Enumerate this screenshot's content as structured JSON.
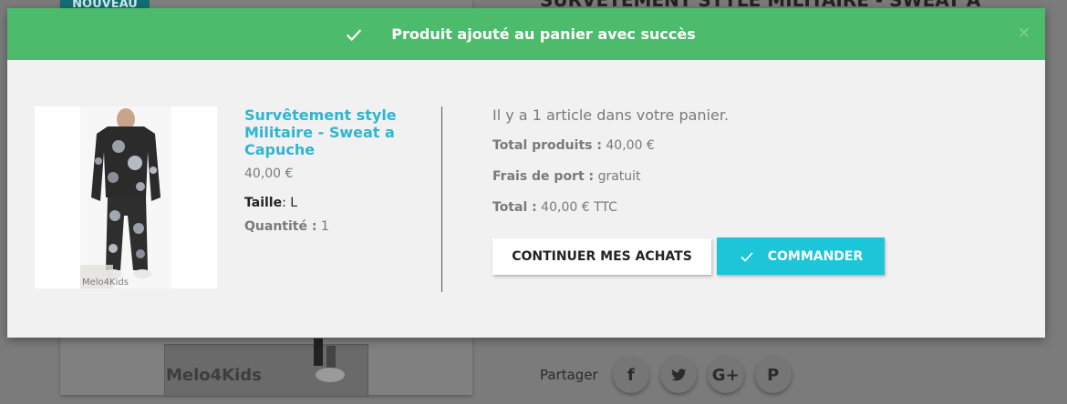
{
  "background": {
    "badge_new": "NOUVEAU",
    "product_title": "SURVÊTEMENT STYLE MILITAIRE - SWEAT A",
    "photo_watermark": "Melo4Kids",
    "share_label": "Partager",
    "share_buttons": [
      {
        "icon": "facebook-icon",
        "glyph": "f"
      },
      {
        "icon": "twitter-icon"
      },
      {
        "icon": "google-plus-icon",
        "glyph": "G+"
      },
      {
        "icon": "pinterest-icon",
        "glyph": "P"
      }
    ]
  },
  "modal": {
    "header_title": "Produit ajouté au panier avec succès",
    "close_glyph": "×",
    "product": {
      "name": "Survêtement style Militaire - Sweat a Capuche",
      "price": "40,00 €",
      "size_label": "Taille",
      "size_value": ": L",
      "quantity_label": "Quantité :",
      "quantity_value": " 1",
      "image_watermark": "Melo4Kids"
    },
    "cart": {
      "count_text": "Il y a 1 article dans votre panier.",
      "total_products_label": "Total produits :",
      "total_products_value": " 40,00 €",
      "shipping_label": "Frais de port :",
      "shipping_value": " gratuit",
      "total_label": "Total :",
      "total_value": " 40,00 € TTC"
    },
    "buttons": {
      "continue": "CONTINUER MES ACHATS",
      "order": "COMMANDER"
    }
  },
  "colors": {
    "success": "#4cbb6c",
    "accent": "#2fb5d2",
    "order_button": "#1cc6d8"
  }
}
